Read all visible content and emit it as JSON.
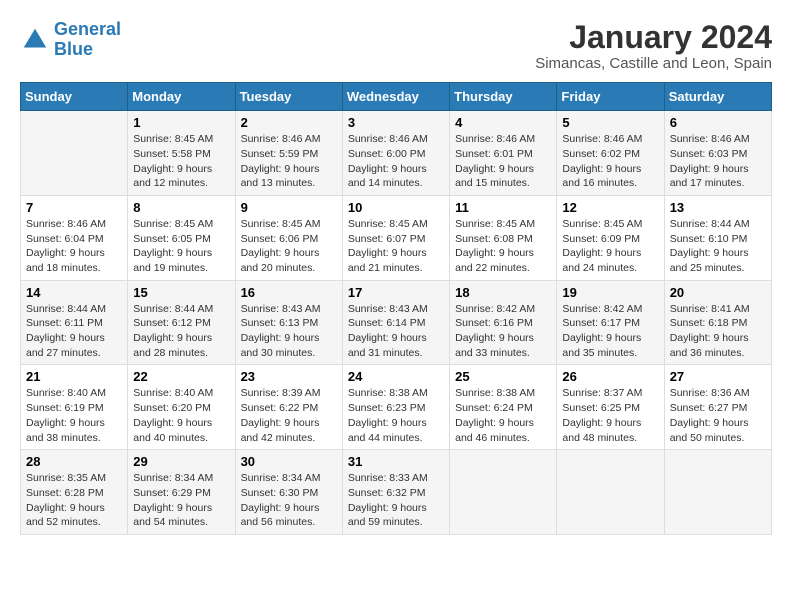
{
  "header": {
    "logo_line1": "General",
    "logo_line2": "Blue",
    "title": "January 2024",
    "subtitle": "Simancas, Castille and Leon, Spain"
  },
  "calendar": {
    "days_of_week": [
      "Sunday",
      "Monday",
      "Tuesday",
      "Wednesday",
      "Thursday",
      "Friday",
      "Saturday"
    ],
    "weeks": [
      [
        {
          "day": "",
          "info": ""
        },
        {
          "day": "1",
          "info": "Sunrise: 8:45 AM\nSunset: 5:58 PM\nDaylight: 9 hours\nand 12 minutes."
        },
        {
          "day": "2",
          "info": "Sunrise: 8:46 AM\nSunset: 5:59 PM\nDaylight: 9 hours\nand 13 minutes."
        },
        {
          "day": "3",
          "info": "Sunrise: 8:46 AM\nSunset: 6:00 PM\nDaylight: 9 hours\nand 14 minutes."
        },
        {
          "day": "4",
          "info": "Sunrise: 8:46 AM\nSunset: 6:01 PM\nDaylight: 9 hours\nand 15 minutes."
        },
        {
          "day": "5",
          "info": "Sunrise: 8:46 AM\nSunset: 6:02 PM\nDaylight: 9 hours\nand 16 minutes."
        },
        {
          "day": "6",
          "info": "Sunrise: 8:46 AM\nSunset: 6:03 PM\nDaylight: 9 hours\nand 17 minutes."
        }
      ],
      [
        {
          "day": "7",
          "info": "Sunrise: 8:46 AM\nSunset: 6:04 PM\nDaylight: 9 hours\nand 18 minutes."
        },
        {
          "day": "8",
          "info": "Sunrise: 8:45 AM\nSunset: 6:05 PM\nDaylight: 9 hours\nand 19 minutes."
        },
        {
          "day": "9",
          "info": "Sunrise: 8:45 AM\nSunset: 6:06 PM\nDaylight: 9 hours\nand 20 minutes."
        },
        {
          "day": "10",
          "info": "Sunrise: 8:45 AM\nSunset: 6:07 PM\nDaylight: 9 hours\nand 21 minutes."
        },
        {
          "day": "11",
          "info": "Sunrise: 8:45 AM\nSunset: 6:08 PM\nDaylight: 9 hours\nand 22 minutes."
        },
        {
          "day": "12",
          "info": "Sunrise: 8:45 AM\nSunset: 6:09 PM\nDaylight: 9 hours\nand 24 minutes."
        },
        {
          "day": "13",
          "info": "Sunrise: 8:44 AM\nSunset: 6:10 PM\nDaylight: 9 hours\nand 25 minutes."
        }
      ],
      [
        {
          "day": "14",
          "info": "Sunrise: 8:44 AM\nSunset: 6:11 PM\nDaylight: 9 hours\nand 27 minutes."
        },
        {
          "day": "15",
          "info": "Sunrise: 8:44 AM\nSunset: 6:12 PM\nDaylight: 9 hours\nand 28 minutes."
        },
        {
          "day": "16",
          "info": "Sunrise: 8:43 AM\nSunset: 6:13 PM\nDaylight: 9 hours\nand 30 minutes."
        },
        {
          "day": "17",
          "info": "Sunrise: 8:43 AM\nSunset: 6:14 PM\nDaylight: 9 hours\nand 31 minutes."
        },
        {
          "day": "18",
          "info": "Sunrise: 8:42 AM\nSunset: 6:16 PM\nDaylight: 9 hours\nand 33 minutes."
        },
        {
          "day": "19",
          "info": "Sunrise: 8:42 AM\nSunset: 6:17 PM\nDaylight: 9 hours\nand 35 minutes."
        },
        {
          "day": "20",
          "info": "Sunrise: 8:41 AM\nSunset: 6:18 PM\nDaylight: 9 hours\nand 36 minutes."
        }
      ],
      [
        {
          "day": "21",
          "info": "Sunrise: 8:40 AM\nSunset: 6:19 PM\nDaylight: 9 hours\nand 38 minutes."
        },
        {
          "day": "22",
          "info": "Sunrise: 8:40 AM\nSunset: 6:20 PM\nDaylight: 9 hours\nand 40 minutes."
        },
        {
          "day": "23",
          "info": "Sunrise: 8:39 AM\nSunset: 6:22 PM\nDaylight: 9 hours\nand 42 minutes."
        },
        {
          "day": "24",
          "info": "Sunrise: 8:38 AM\nSunset: 6:23 PM\nDaylight: 9 hours\nand 44 minutes."
        },
        {
          "day": "25",
          "info": "Sunrise: 8:38 AM\nSunset: 6:24 PM\nDaylight: 9 hours\nand 46 minutes."
        },
        {
          "day": "26",
          "info": "Sunrise: 8:37 AM\nSunset: 6:25 PM\nDaylight: 9 hours\nand 48 minutes."
        },
        {
          "day": "27",
          "info": "Sunrise: 8:36 AM\nSunset: 6:27 PM\nDaylight: 9 hours\nand 50 minutes."
        }
      ],
      [
        {
          "day": "28",
          "info": "Sunrise: 8:35 AM\nSunset: 6:28 PM\nDaylight: 9 hours\nand 52 minutes."
        },
        {
          "day": "29",
          "info": "Sunrise: 8:34 AM\nSunset: 6:29 PM\nDaylight: 9 hours\nand 54 minutes."
        },
        {
          "day": "30",
          "info": "Sunrise: 8:34 AM\nSunset: 6:30 PM\nDaylight: 9 hours\nand 56 minutes."
        },
        {
          "day": "31",
          "info": "Sunrise: 8:33 AM\nSunset: 6:32 PM\nDaylight: 9 hours\nand 59 minutes."
        },
        {
          "day": "",
          "info": ""
        },
        {
          "day": "",
          "info": ""
        },
        {
          "day": "",
          "info": ""
        }
      ]
    ]
  }
}
